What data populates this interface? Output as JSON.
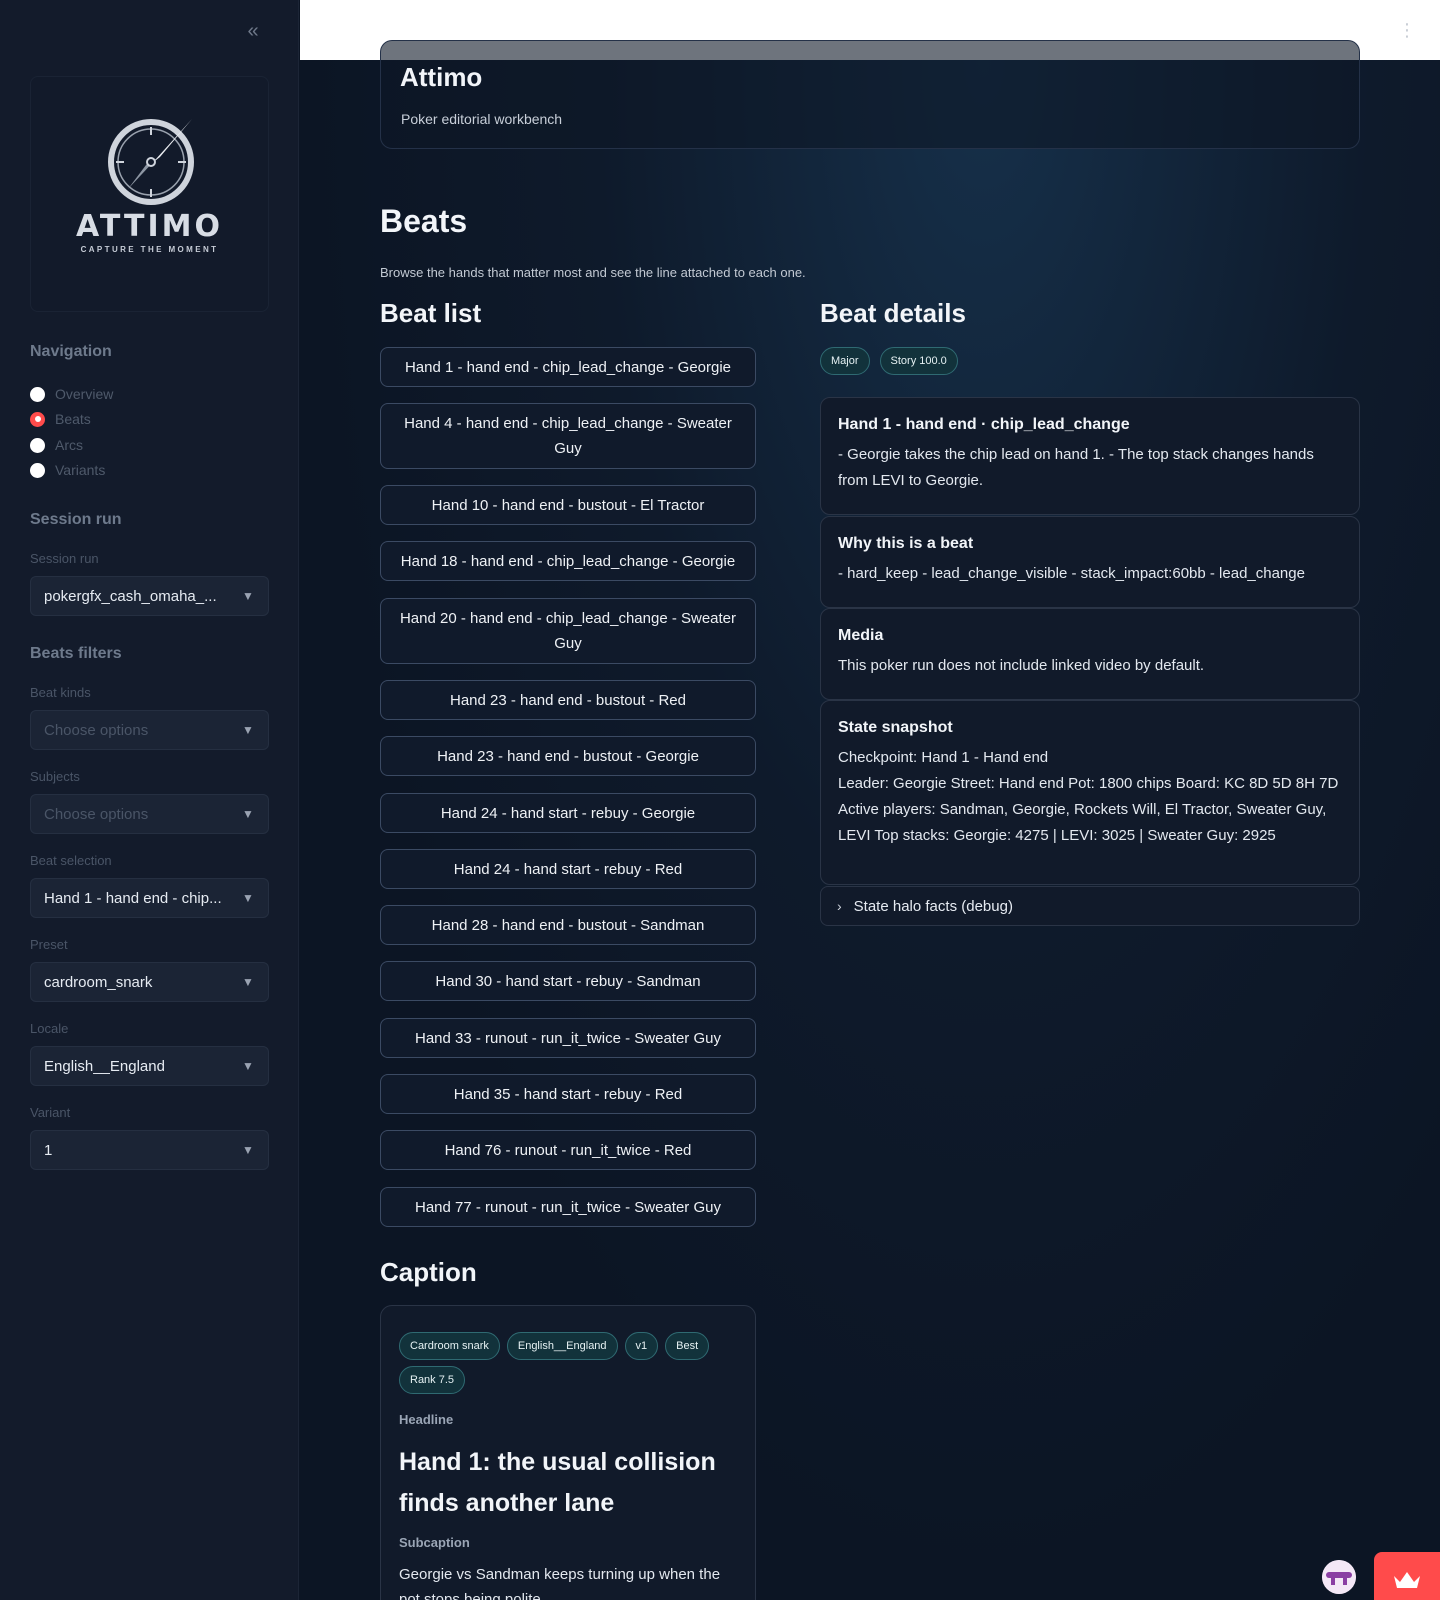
{
  "sidebar": {
    "collapse_icon": "chevrons-left-icon",
    "logo": {
      "word": "ATTIMO",
      "tagline": "CAPTURE THE MOMENT"
    },
    "navigation": {
      "heading": "Navigation",
      "items": [
        {
          "label": "Overview",
          "selected": false
        },
        {
          "label": "Beats",
          "selected": true
        },
        {
          "label": "Arcs",
          "selected": false
        },
        {
          "label": "Variants",
          "selected": false
        }
      ]
    },
    "session": {
      "heading": "Session run",
      "label": "Session run",
      "value": "pokergfx_cash_omaha_..."
    },
    "filters": {
      "heading": "Beats filters",
      "beat_kinds": {
        "label": "Beat kinds",
        "placeholder": "Choose options"
      },
      "subjects": {
        "label": "Subjects",
        "placeholder": "Choose options"
      },
      "beat_selection": {
        "label": "Beat selection",
        "value": "Hand 1 - hand end - chip..."
      },
      "preset": {
        "label": "Preset",
        "value": "cardroom_snark"
      },
      "locale": {
        "label": "Locale",
        "value": "English__England"
      },
      "variant": {
        "label": "Variant",
        "value": "1"
      }
    }
  },
  "header": {
    "menu_icon": "more-vertical-icon"
  },
  "app": {
    "title": "Attimo",
    "subtitle": "Poker editorial workbench"
  },
  "page": {
    "title": "Beats",
    "description": "Browse the hands that matter most and see the line attached to each one."
  },
  "beat_list": {
    "title": "Beat list",
    "items": [
      "Hand 1 - hand end - chip_lead_change - Georgie",
      "Hand 4 - hand end - chip_lead_change - Sweater Guy",
      "Hand 10 - hand end - bustout - El Tractor",
      "Hand 18 - hand end - chip_lead_change - Georgie",
      "Hand 20 - hand end - chip_lead_change - Sweater Guy",
      "Hand 23 - hand end - bustout - Red",
      "Hand 23 - hand end - bustout - Georgie",
      "Hand 24 - hand start - rebuy - Georgie",
      "Hand 24 - hand start - rebuy - Red",
      "Hand 28 - hand end - bustout - Sandman",
      "Hand 30 - hand start - rebuy - Sandman",
      "Hand 33 - runout - run_it_twice - Sweater Guy",
      "Hand 35 - hand start - rebuy - Red",
      "Hand 76 - runout - run_it_twice - Red",
      "Hand 77 - runout - run_it_twice - Sweater Guy"
    ]
  },
  "beat_details": {
    "title": "Beat details",
    "badges": [
      "Major",
      "Story 100.0"
    ],
    "summary": {
      "title": "Hand 1 - hand end · chip_lead_change",
      "body": "- Georgie takes the chip lead on hand 1. - The top stack changes hands from LEVI to Georgie."
    },
    "why": {
      "title": "Why this is a beat",
      "body": "- hard_keep - lead_change_visible - stack_impact:60bb - lead_change"
    },
    "media": {
      "title": "Media",
      "body": "This poker run does not include linked video by default."
    },
    "snapshot": {
      "title": "State snapshot",
      "lines": [
        "Checkpoint: Hand 1 - Hand end",
        "Leader: Georgie Street: Hand end Pot: 1800 chips Board: KC 8D 5D 8H 7D",
        "Active players: Sandman, Georgie, Rockets Will, El Tractor, Sweater Guy,",
        "LEVI Top stacks: Georgie: 4275 | LEVI: 3025 | Sweater Guy: 2925"
      ]
    },
    "expander": {
      "label": "State halo facts (debug)",
      "icon": "chevron-right-icon"
    }
  },
  "caption": {
    "title": "Caption",
    "tags": [
      "Cardroom snark",
      "English__England",
      "v1",
      "Best",
      "Rank 7.5"
    ],
    "headline_label": "Headline",
    "headline": "Hand 1: the usual collision finds another lane",
    "subcaption_label": "Subcaption",
    "subcaption": "Georgie vs Sandman keeps turning up when the pot stops being polite."
  },
  "floating": {
    "avatar_icon": "avatar-icon",
    "crown_icon": "crown-icon"
  },
  "colors": {
    "accent": "#ff4b4b",
    "pill_bg": "#12323b",
    "pill_border": "#2f6a72"
  }
}
